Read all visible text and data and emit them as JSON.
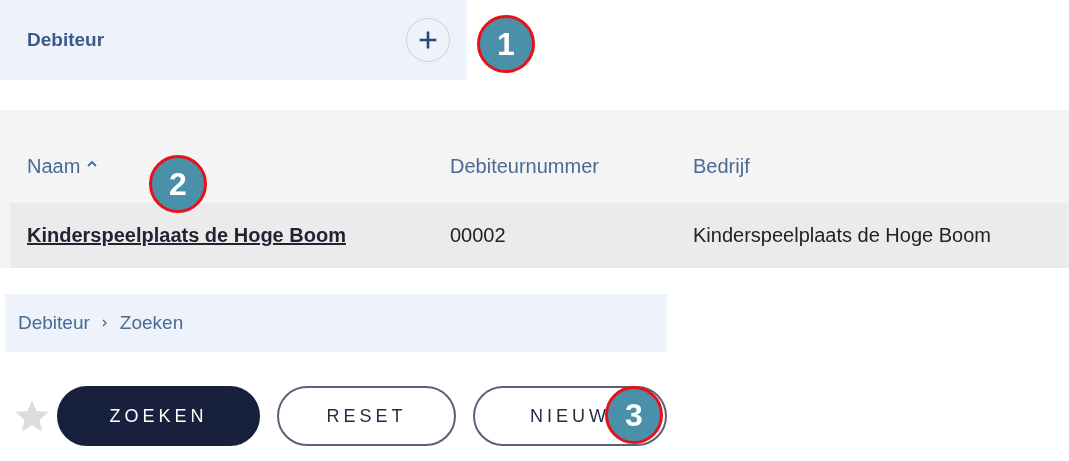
{
  "panel": {
    "title": "Debiteur"
  },
  "table": {
    "columns": [
      {
        "label": "Naam",
        "sorted": true
      },
      {
        "label": "Debiteurnummer",
        "sorted": false
      },
      {
        "label": "Bedrijf",
        "sorted": false
      }
    ],
    "rows": [
      {
        "cells": [
          "Kinderspeelplaats de Hoge Boom",
          "00002",
          "Kinderspeelplaats de Hoge Boom"
        ]
      }
    ]
  },
  "breadcrumb": [
    "Debiteur",
    "Zoeken"
  ],
  "favorite": false,
  "buttons": [
    {
      "label": "ZOEKEN",
      "kind": "primary"
    },
    {
      "label": "RESET",
      "kind": "outline"
    },
    {
      "label": "NIEUW",
      "kind": "outline"
    }
  ],
  "markers": [
    "1",
    "2",
    "3"
  ]
}
